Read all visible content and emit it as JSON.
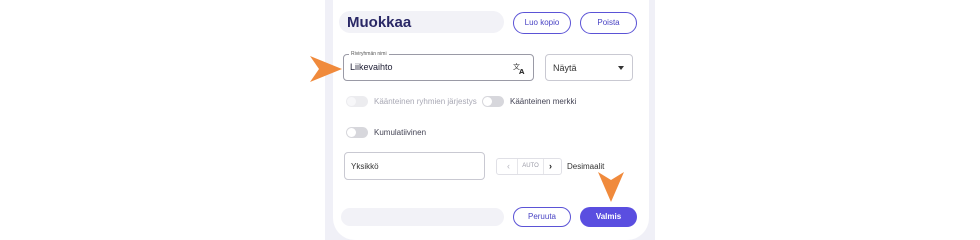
{
  "header": {
    "title": "Muokkaa",
    "copy_label": "Luo kopio",
    "delete_label": "Poista"
  },
  "group_name": {
    "legend": "Riviryhmän nimi",
    "value": "Liikevaihto",
    "translate_icon": "translate-icon"
  },
  "show_select": {
    "selected": "Näytä"
  },
  "toggles": {
    "reverse_group_order": {
      "label": "Käänteinen ryhmien järjestys",
      "enabled": false,
      "on": false
    },
    "reverse_sign": {
      "label": "Käänteinen merkki",
      "enabled": true,
      "on": false
    },
    "cumulative": {
      "label": "Kumulatiivinen",
      "enabled": true,
      "on": false
    }
  },
  "unit": {
    "label": "Yksikkö"
  },
  "decimals": {
    "value": "AUTO",
    "label": "Desimaalit",
    "prev_icon": "chevron-left-icon",
    "next_icon": "chevron-right-icon"
  },
  "footer": {
    "cancel_label": "Peruuta",
    "done_label": "Valmis"
  },
  "colors": {
    "accent": "#5a4ee0",
    "pointer_arrow": "#f08a3c"
  }
}
